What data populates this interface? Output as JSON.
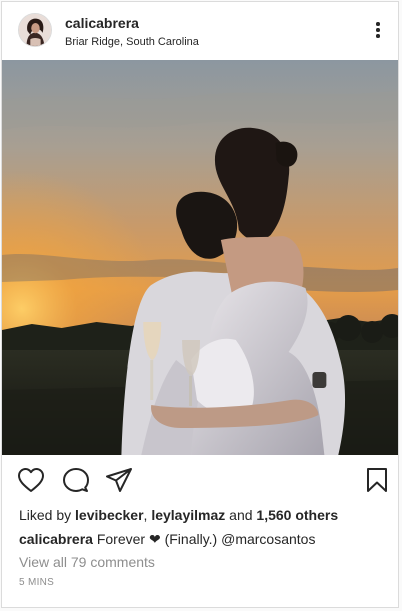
{
  "post": {
    "username": "calicabrera",
    "location": "Briar Ridge, South Carolina",
    "likes": {
      "prefix": "Liked by",
      "user1": "levibecker",
      "separator": ",",
      "user2": "leylayilmaz",
      "and_word": "and",
      "others": "1,560 others"
    },
    "caption": {
      "username": "calicabrera",
      "text": "Forever ❤  (Finally.)",
      "mention": "@marcosantos"
    },
    "view_comments": "View all 79 comments",
    "timestamp": "5 MINS"
  },
  "icons": {
    "more": "more-options-icon",
    "like": "heart-icon",
    "comment": "comment-bubble-icon",
    "share": "paper-plane-icon",
    "save": "bookmark-icon"
  },
  "colors": {
    "text": "#262626",
    "muted": "#8e8e8e",
    "border": "#dbdbdb",
    "sky_top": "#8c9aa6",
    "sky_glow": "#f0a640"
  }
}
